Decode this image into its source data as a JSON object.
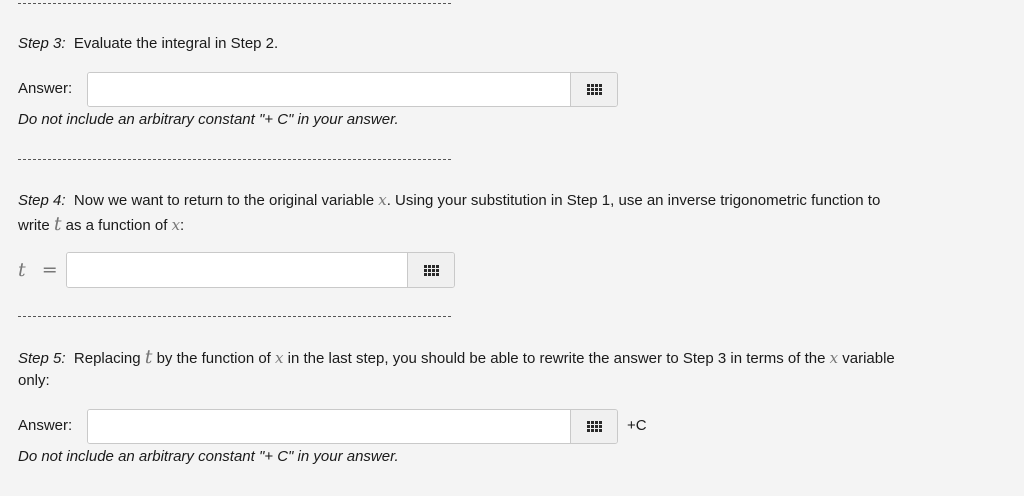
{
  "step3": {
    "prefix": "Step 3:",
    "text": "Evaluate the integral in Step 2.",
    "answer_label": "Answer:",
    "answer_value": "",
    "note": "Do not include an arbitrary constant \"+ C\" in your answer."
  },
  "step4": {
    "prefix": "Step 4:",
    "line1_a": "Now we want to return to the original variable ",
    "line1_var": "x",
    "line1_b": ". Using your substitution in Step 1, use an inverse trigonometric function to",
    "line2_a": "write ",
    "line2_var1": "t",
    "line2_b": " as a function of ",
    "line2_var2": "x",
    "line2_c": ":",
    "eq_lhs": "t",
    "eq_sign": "=",
    "answer_value": ""
  },
  "step5": {
    "prefix": "Step 5:",
    "line1_a": "Replacing ",
    "line1_var1": "t",
    "line1_b": " by the function of ",
    "line1_var2": "x",
    "line1_c": " in the last step, you should be able to rewrite the answer to Step 3 in terms of the ",
    "line1_var3": "x",
    "line1_d": " variable",
    "line2": "only:",
    "answer_label": "Answer:",
    "answer_value": "",
    "suffix": "+C",
    "note": "Do not include an arbitrary constant \"+ C\" in your answer."
  },
  "icons": {
    "keyboard": "keypad-grid-icon"
  }
}
